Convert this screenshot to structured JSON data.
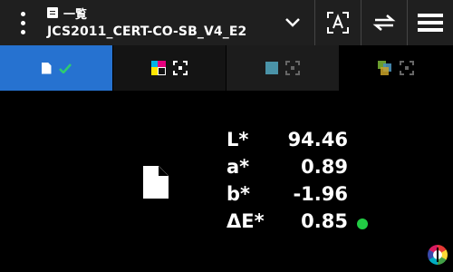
{
  "header": {
    "title_top": "一覧",
    "title_main": "JCS2011_CERT-CO-SB_V4_E2"
  },
  "tabs": [
    {
      "icon": "document-check-icon",
      "active": true
    },
    {
      "icon": "color-patch-target-icon",
      "active": false
    },
    {
      "icon": "teal-patch-target-icon",
      "active": false
    },
    {
      "icon": "multi-patch-target-icon",
      "active": false
    }
  ],
  "measurements": [
    {
      "label": "L*",
      "value": "94.46"
    },
    {
      "label": "a*",
      "value": "0.89"
    },
    {
      "label": "b*",
      "value": "-1.96"
    },
    {
      "label": "ΔE*",
      "value": "0.85"
    }
  ],
  "colors": {
    "active_tab": "#2672d0",
    "check": "#2ecc71",
    "status_ok": "#22cc44"
  }
}
